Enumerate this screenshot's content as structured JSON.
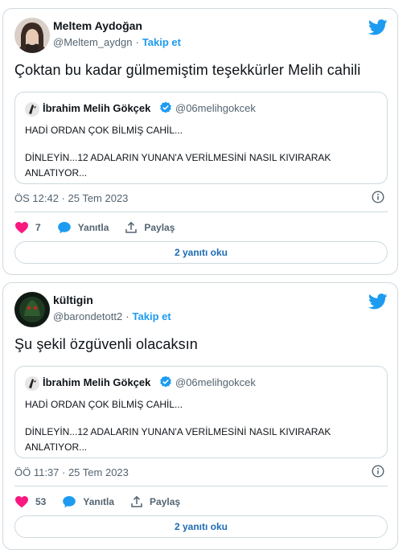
{
  "colors": {
    "accent": "#1d9bf0",
    "heart": "#f91880",
    "verified": "#1d9bf0",
    "border": "#cfd9de",
    "secondary_text": "#536471"
  },
  "icons": {
    "brand": "twitter-bird-icon",
    "like": "heart-icon",
    "reply": "reply-bubble-icon",
    "share": "share-upload-icon",
    "info": "info-icon",
    "verified": "verified-badge-icon"
  },
  "tweets": [
    {
      "author": {
        "name": "Meltem Aydoğan",
        "handle": "@Meltem_aydgn",
        "separator": "·",
        "follow_label": "Takip et"
      },
      "text": "Çoktan bu kadar gülmemiştim teşekkürler Melih cahili",
      "quote": {
        "name": "İbrahim Melih Gökçek",
        "handle": "@06melihgokcek",
        "line1": "HADİ ORDAN ÇOK BİLMİŞ CAHİL...",
        "line2": "DİNLEYİN...12 ADALARIN YUNAN'A VERİLMESİNİ NASIL KIVIRARAK",
        "line3": "ANLATIYOR..."
      },
      "timestamp": "ÖS 12:42 · 25 Tem 2023",
      "likes": "7",
      "reply_label": "Yanıtla",
      "share_label": "Paylaş",
      "read_replies_label": "2 yanıtı oku"
    },
    {
      "author": {
        "name": "kültigin",
        "handle": "@barondetott2",
        "separator": "·",
        "follow_label": "Takip et"
      },
      "text": "Şu şekil özgüvenli olacaksın",
      "quote": {
        "name": "İbrahim Melih Gökçek",
        "handle": "@06melihgokcek",
        "line1": "HADİ ORDAN ÇOK BİLMİŞ CAHİL...",
        "line2": "DİNLEYİN...12 ADALARIN YUNAN'A VERİLMESİNİ NASIL KIVIRARAK",
        "line3": "ANLATIYOR..."
      },
      "timestamp": "ÖÖ 11:37 · 25 Tem 2023",
      "likes": "53",
      "reply_label": "Yanıtla",
      "share_label": "Paylaş",
      "read_replies_label": "2 yanıtı oku"
    }
  ]
}
